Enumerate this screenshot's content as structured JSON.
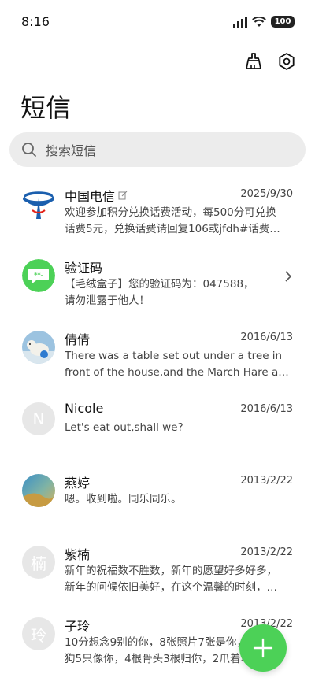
{
  "status_bar": {
    "time": "8:16",
    "battery": "100"
  },
  "header": {
    "title": "短信"
  },
  "search": {
    "placeholder": "搜索短信"
  },
  "conversations": [
    {
      "name": "中国电信",
      "date": "2025/9/30",
      "line1": "欢迎参加积分兑换话费活动，每500分可兑换",
      "line2": "话费5元，兑换话费请回复106或jfdh#话费…",
      "avatar": "china-telecom-logo"
    },
    {
      "name": "验证码",
      "date": "",
      "line1": "【毛绒盒子】您的验证码为：047588，",
      "line2": "请勿泄露于他人！",
      "avatar": "verification-code-icon"
    },
    {
      "name": "倩倩",
      "date": "2016/6/13",
      "line1": "There was a table set out under a tree in",
      "line2": "front of the house,and the March Hare an…",
      "avatar": "polar-bear-photo"
    },
    {
      "name": "Nicole",
      "date": "2016/6/13",
      "line1": "Let's eat out,shall we?",
      "line2": "",
      "avatar_letter": "N"
    },
    {
      "name": "燕婷",
      "date": "2013/2/22",
      "line1": "嗯。收到啦。同乐同乐。",
      "line2": "",
      "avatar": "landscape-photo"
    },
    {
      "name": "紫楠",
      "date": "2013/2/22",
      "line1": "新年的祝福数不胜数，新年的愿望好多好多，",
      "line2": "新年的问候依旧美好，在这个温馨的时刻，…",
      "avatar_letter": "楠"
    },
    {
      "name": "子玲",
      "date": "2013/2/22",
      "line1": "10分想念9别的你，8张照片7张是你，6只小",
      "line2": "狗5只像你，4根骨头3根归你，2爪着地1定…",
      "avatar_letter": "玲"
    }
  ],
  "colors": {
    "accent_green": "#4cd157",
    "telecom_blue": "#1b5fae"
  }
}
